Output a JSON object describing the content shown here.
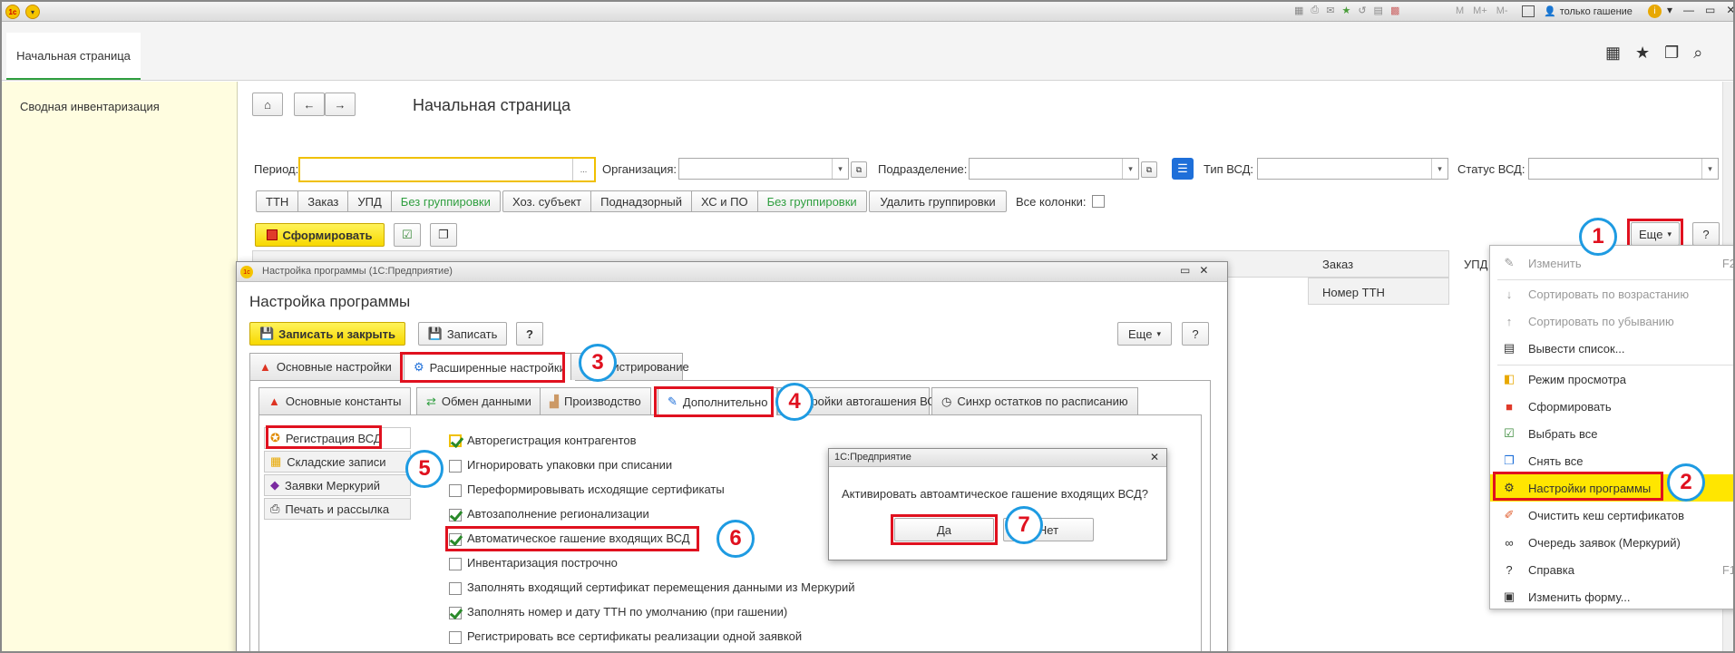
{
  "titlebar": {
    "user": "только гашение",
    "m_labels": [
      "M",
      "M+",
      "M-"
    ]
  },
  "tabs": {
    "home": "Начальная страница"
  },
  "sidebar": {
    "item": "Сводная инвентаризация"
  },
  "page": {
    "title": "Начальная страница",
    "period_label": "Период:",
    "period_ellipsis": "...",
    "org_label": "Организация:",
    "dept_label": "Подразделение:",
    "vsd_type_label": "Тип ВСД:",
    "vsd_status_label": "Статус ВСД:",
    "group1": [
      "ТТН",
      "Заказ",
      "УПД",
      "Без группировки"
    ],
    "group2": [
      "Хоз. субъект",
      "Поднадзорный",
      "ХС и ПО",
      "Без группировки"
    ],
    "delete_groupings": "Удалить группировки",
    "all_columns": "Все колонки:",
    "generate": "Сформировать",
    "more": "Еще",
    "help": "?",
    "col_order": "Заказ",
    "col_upd": "УПД",
    "sub_ttn": "Номер ТТН"
  },
  "menu": {
    "items": [
      {
        "label": "Изменить",
        "shortcut": "F2",
        "disabled": true,
        "icon": "✎"
      },
      {
        "label": "Сортировать по возрастанию",
        "disabled": true,
        "icon": "↓"
      },
      {
        "label": "Сортировать по убыванию",
        "disabled": true,
        "icon": "↑"
      },
      {
        "label": "Вывести список...",
        "icon": "▤"
      },
      {
        "label": "Режим просмотра",
        "icon": "◧",
        "submenu": true
      },
      {
        "label": "Сформировать",
        "icon": "■"
      },
      {
        "label": "Выбрать все",
        "icon": "☑"
      },
      {
        "label": "Снять все",
        "icon": "❐"
      },
      {
        "label": "Настройки программы",
        "icon": "⚙",
        "highlight": true
      },
      {
        "label": "Очистить кеш сертификатов",
        "icon": "✐"
      },
      {
        "label": "Очередь заявок (Меркурий)",
        "icon": "∞"
      },
      {
        "label": "Справка",
        "shortcut": "F1",
        "icon": "?"
      },
      {
        "label": "Изменить форму...",
        "icon": "▣"
      }
    ]
  },
  "dialog": {
    "window_title": "Настройка программы (1С:Предприятие)",
    "title": "Настройка программы",
    "save_close": "Записать и закрыть",
    "save": "Записать",
    "help": "?",
    "more": "Еще",
    "tabs1": [
      "Основные настройки",
      "Расширенные настройки",
      "министрирование"
    ],
    "tabs2": [
      "Основные константы",
      "Обмен данными",
      "Производство",
      "Дополнительно",
      "стройки автогашения ВСД",
      "Синхр остатков по расписанию"
    ],
    "left_items": [
      "Регистрация ВСД",
      "Складские записи",
      "Заявки Меркурий",
      "Печать и рассылка"
    ],
    "options": [
      {
        "label": "Авторегистрация контрагентов",
        "checked": true
      },
      {
        "label": "Игнорировать упаковки при списании",
        "checked": false
      },
      {
        "label": "Переформировывать исходящие сертификаты",
        "checked": false
      },
      {
        "label": "Автозаполнение регионализации",
        "checked": true
      },
      {
        "label": "Автоматическое гашение входящих ВСД",
        "checked": true
      },
      {
        "label": "Инвентаризация построчно",
        "checked": false
      },
      {
        "label": "Заполнять входящий сертификат перемещения данными из Меркурий",
        "checked": false
      },
      {
        "label": "Заполнять номер и дату ТТН по умолчанию (при гашении)",
        "checked": true
      },
      {
        "label": "Регистрировать все сертификаты реализации одной заявкой",
        "checked": false
      }
    ]
  },
  "confirm": {
    "title": "1С:Предприятие",
    "question": "Активировать автоамтическое гашение входящих ВСД?",
    "yes": "Да",
    "no": "Нет"
  },
  "markers": [
    "1",
    "2",
    "3",
    "4",
    "5",
    "6",
    "7"
  ],
  "colors": {
    "accent_red": "#e0111f",
    "marker_blue": "#1e9be2",
    "yellow": "#ffe600",
    "sidebar_bg": "#fffde0",
    "green": "#2f9e3f"
  }
}
